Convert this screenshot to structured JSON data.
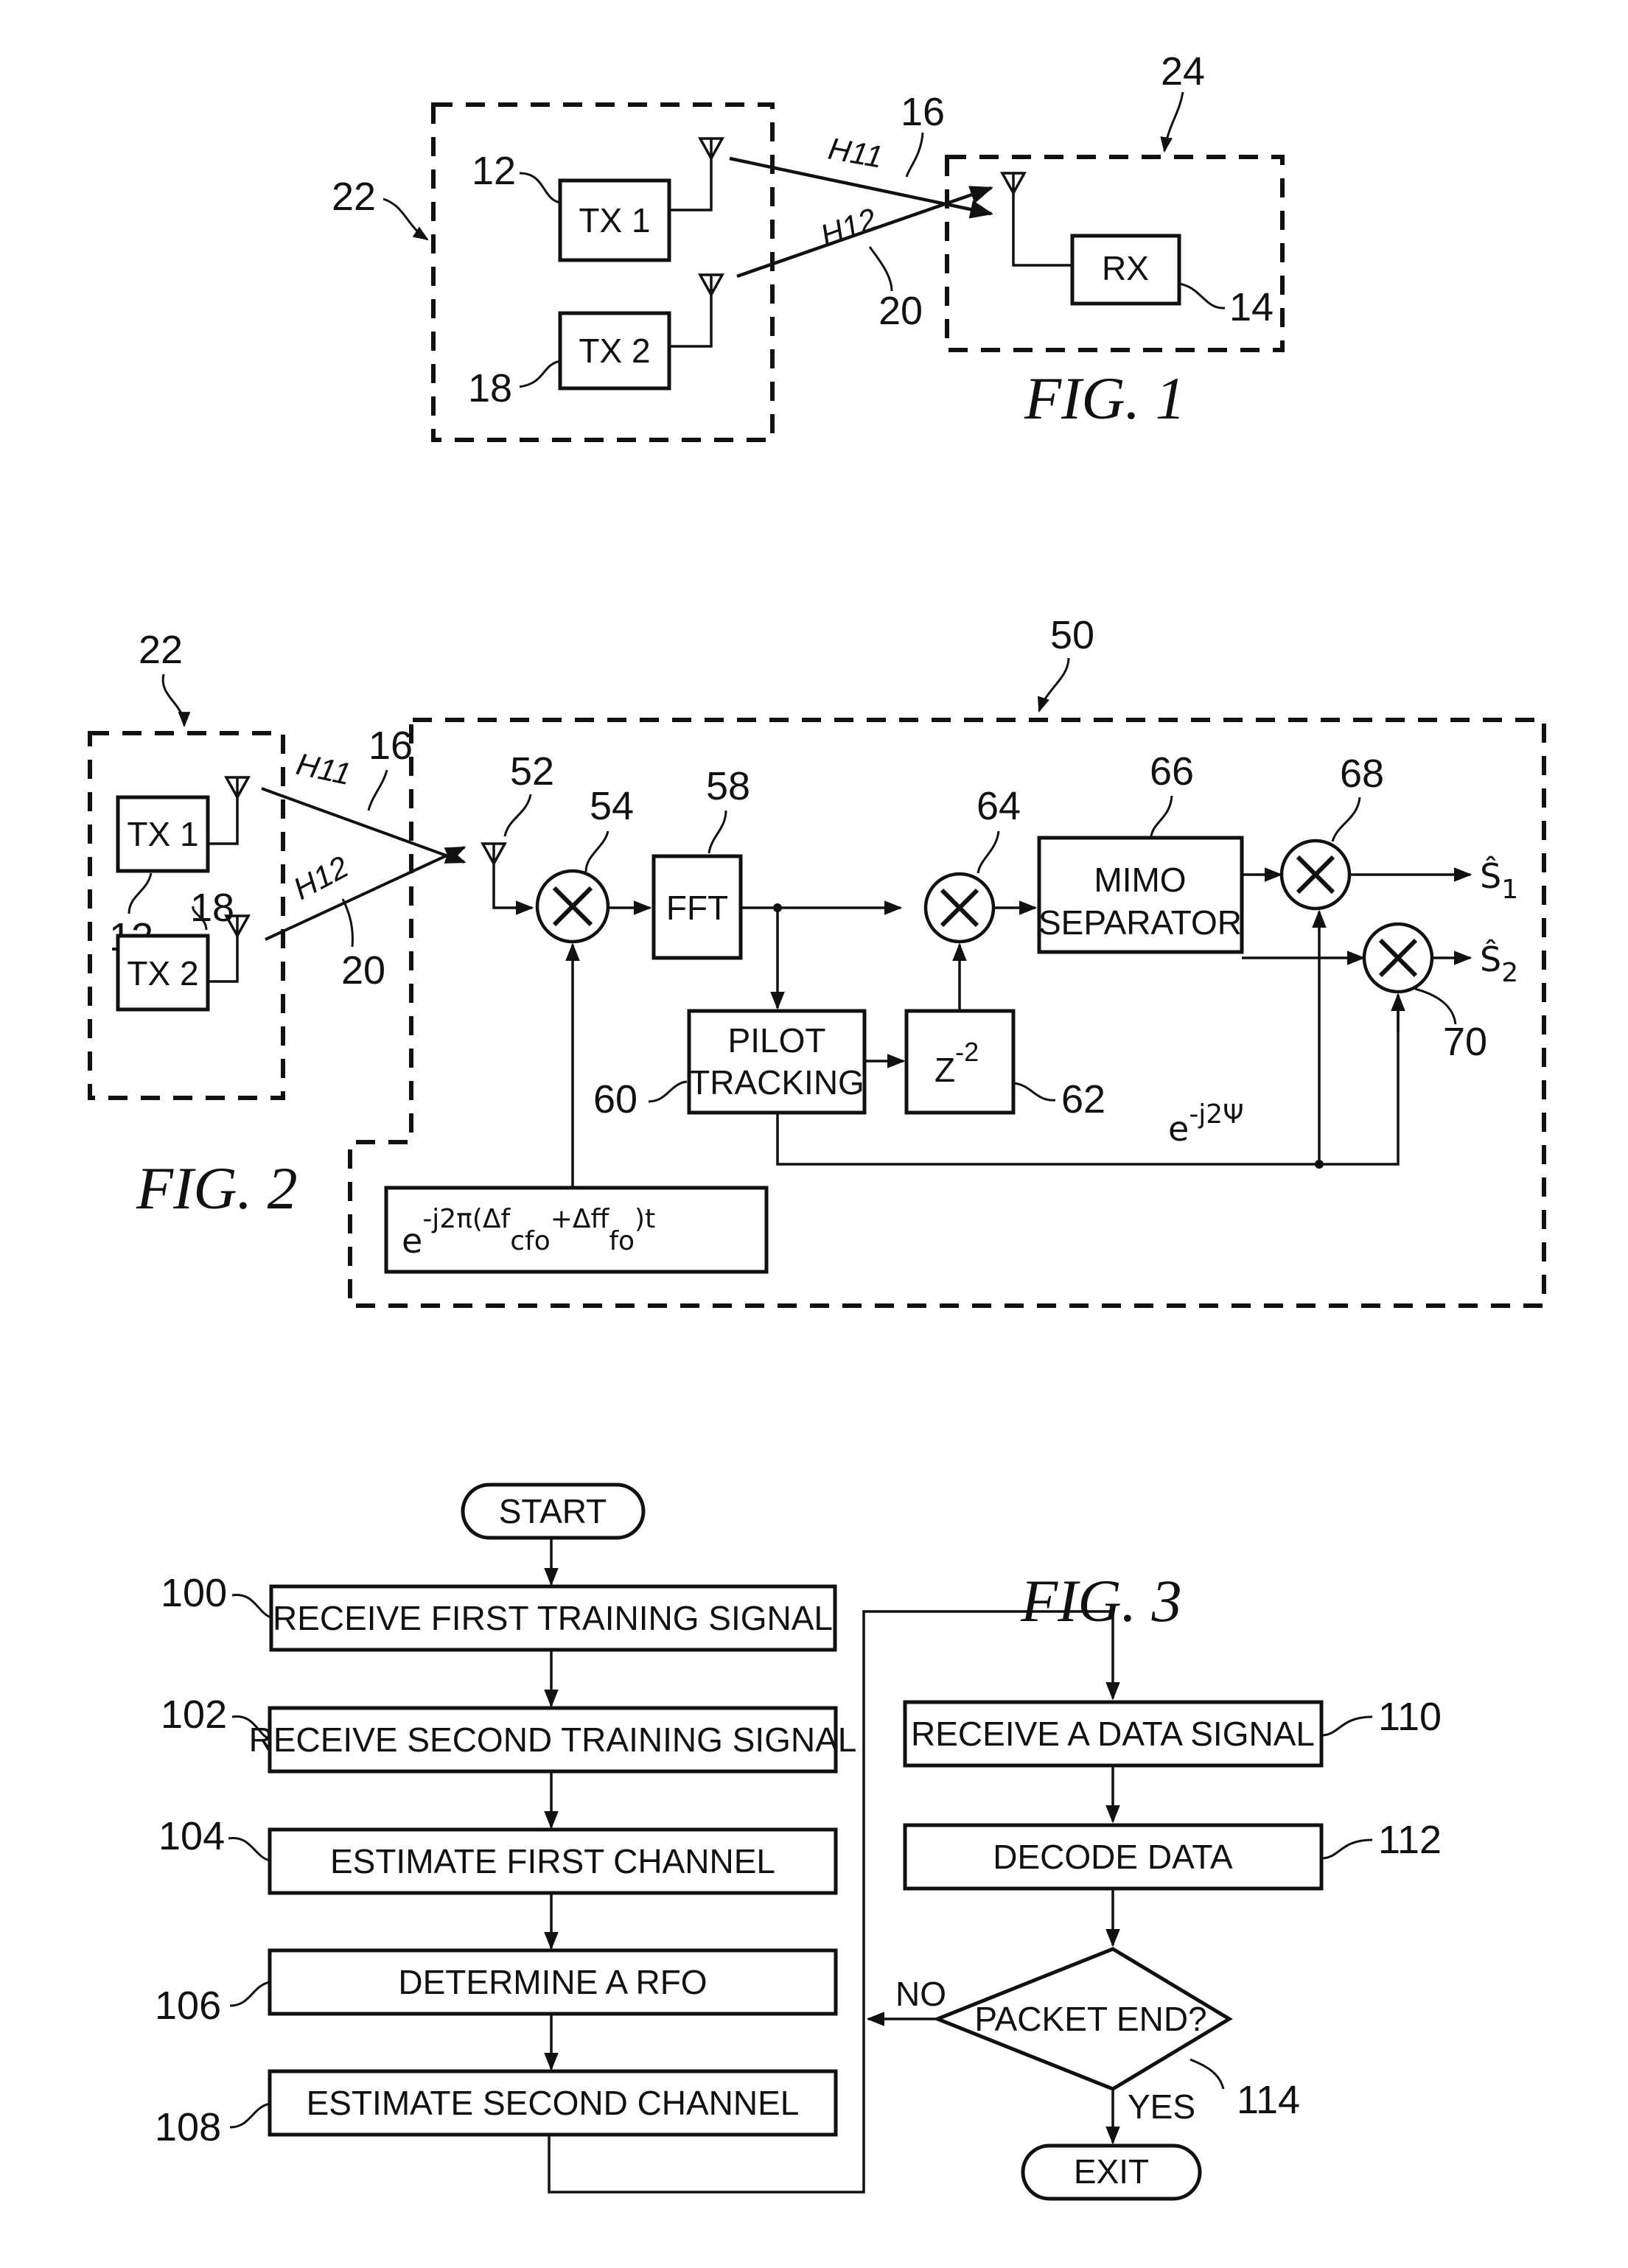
{
  "fig1": {
    "caption": "FIG. 1",
    "transmitter_group_ref": "22",
    "receiver_group_ref": "24",
    "tx1": {
      "label": "TX 1",
      "ref": "12"
    },
    "tx2": {
      "label": "TX 2",
      "ref": "18"
    },
    "rx": {
      "label": "RX",
      "ref": "14"
    },
    "channel1": {
      "label": "H11",
      "ref": "16"
    },
    "channel2": {
      "label": "H12",
      "ref": "20"
    }
  },
  "fig2": {
    "caption": "FIG. 2",
    "transmitter_group_ref": "22",
    "receiver_ref": "50",
    "tx1": {
      "label": "TX 1",
      "ref": "12"
    },
    "tx2": {
      "label": "TX 2",
      "ref": "18"
    },
    "channel1": {
      "label": "H11",
      "ref": "16"
    },
    "channel2": {
      "label": "H12",
      "ref": "20"
    },
    "antenna_ref": "52",
    "mixer1_ref": "54",
    "fft": {
      "label": "FFT",
      "ref": "58"
    },
    "pilot_tracking": {
      "label_line1": "PILOT",
      "label_line2": "TRACKING",
      "ref": "60"
    },
    "delay": {
      "base": "Z",
      "exp": "-2",
      "ref": "62"
    },
    "mixer2_ref": "64",
    "mimo": {
      "label_line1": "MIMO",
      "label_line2": "SEPARATOR",
      "ref": "66"
    },
    "mixer3_ref": "68",
    "mixer4_ref": "70",
    "phase_label": {
      "base": "e",
      "exp": "-j2Ψ"
    },
    "cfo_formula": {
      "base": "e",
      "exp_prefix": "-j2π(Δf",
      "sub1": "cfo",
      "mid": "+Δf",
      "sub2": "ffo",
      "suffix": ")t"
    },
    "output1": {
      "symbol": "Ŝ",
      "sub": "1"
    },
    "output2": {
      "symbol": "Ŝ",
      "sub": "2"
    }
  },
  "fig3": {
    "caption": "FIG. 3",
    "start": "START",
    "exit": "EXIT",
    "steps": [
      {
        "ref": "100",
        "label": "RECEIVE FIRST TRAINING SIGNAL"
      },
      {
        "ref": "102",
        "label": "RECEIVE SECOND TRAINING SIGNAL"
      },
      {
        "ref": "104",
        "label": "ESTIMATE FIRST CHANNEL"
      },
      {
        "ref": "106",
        "label": "DETERMINE A RFO"
      },
      {
        "ref": "108",
        "label": "ESTIMATE SECOND CHANNEL"
      },
      {
        "ref": "110",
        "label": "RECEIVE A DATA SIGNAL"
      },
      {
        "ref": "112",
        "label": "DECODE DATA"
      }
    ],
    "decision": {
      "ref": "114",
      "label": "PACKET END?",
      "no": "NO",
      "yes": "YES"
    }
  }
}
